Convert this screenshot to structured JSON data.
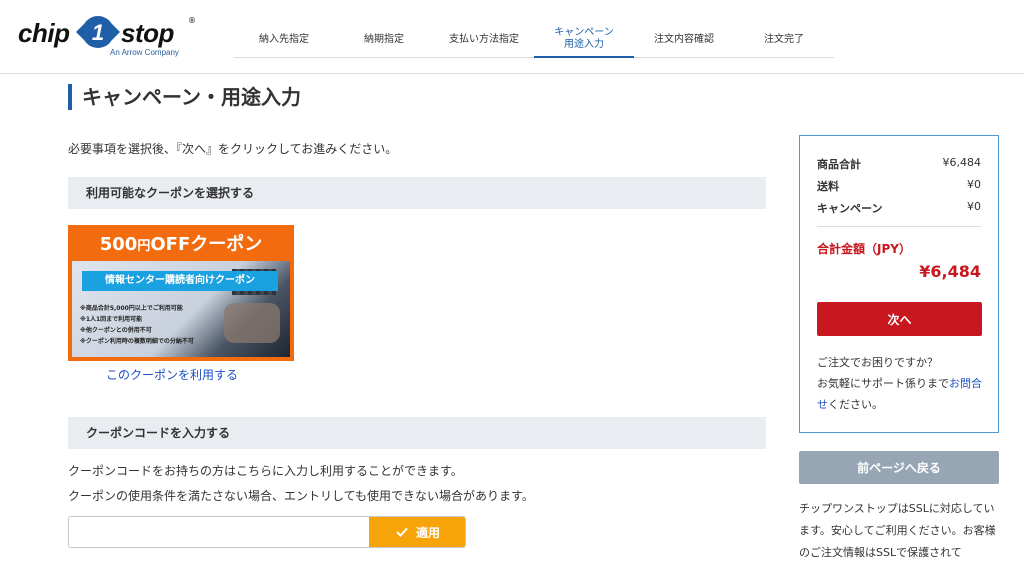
{
  "brand": {
    "chip": "chip",
    "one": "1",
    "stop": "stop",
    "reg": "®",
    "tagline": "An Arrow Company",
    "accent": "#1e5fa8"
  },
  "steps": [
    {
      "label": "納入先指定",
      "active": false
    },
    {
      "label": "納期指定",
      "active": false
    },
    {
      "label": "支払い方法指定",
      "active": false
    },
    {
      "label": "キャンペーン\n用途入力",
      "active": true
    },
    {
      "label": "注文内容確認",
      "active": false
    },
    {
      "label": "注文完了",
      "active": false
    }
  ],
  "main": {
    "title": "キャンペーン・用途入力",
    "intro": "必要事項を選択後、『次へ』をクリックしてお進みください。",
    "coupon_section": "利用可能なクーポンを選択する",
    "coupon": {
      "amount": "500",
      "yen": "円",
      "off": "OFFクーポン",
      "banner": "情報センター購読者向けクーポン",
      "notes": [
        "※商品合計5,000円以上でご利用可能",
        "※1人1回まで利用可能",
        "※他クーポンとの併用不可",
        "※クーポン利用時の複数明細での分納不可"
      ],
      "link": "このクーポンを利用する"
    },
    "code_section": "クーポンコードを入力する",
    "code_text_1": "クーポンコードをお持ちの方はこちらに入力し利用することができます。",
    "code_text_2": "クーポンの使用条件を満たさない場合、エントリしても使用できない場合があります。",
    "code_input": {
      "value": "",
      "placeholder": ""
    },
    "apply_label": "適用",
    "apply_icon": "check-icon"
  },
  "summary": {
    "rows": [
      {
        "label": "商品合計",
        "value": "¥6,484"
      },
      {
        "label": "送料",
        "value": "¥0"
      },
      {
        "label": "キャンペーン",
        "value": "¥0"
      }
    ],
    "total_label": "合計金額（JPY）",
    "total_value": "¥6,484",
    "next_label": "次へ",
    "help_1": "ご注文でお困りですか？",
    "help_2": "お気軽にサポート係りまで",
    "help_link": "お問合せ",
    "help_3": "ください。"
  },
  "back_label": "前ページへ戻る",
  "ssl_text": "チップワンストップはSSLに対応しています。安心してご利用ください。お客様のご注文情報はSSLで保護されて",
  "colors": {
    "accent": "#1e5fa8",
    "red": "#c8171e",
    "orange": "#f26b0f",
    "apply": "#f7a30a",
    "back": "#97a6b5"
  }
}
